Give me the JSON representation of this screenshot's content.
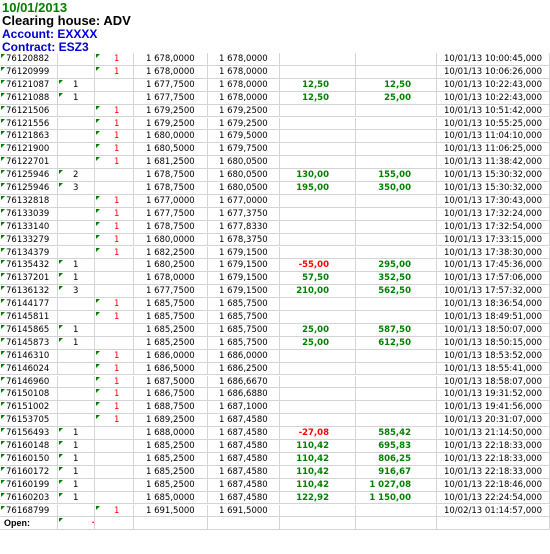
{
  "header": {
    "date": "10/01/2013",
    "clearing_house": "Clearing house: ADV",
    "account": "Account: EXXXX",
    "contract": "Contract: ESZ3"
  },
  "colors": {
    "positive": "#008000",
    "negative": "#ff0000",
    "account": "#0000cc",
    "grid": "#d4d4d4"
  },
  "rows": [
    {
      "id": "76120882",
      "buy": "",
      "sell": "1",
      "price": "1 678,0000",
      "avg": "1 678,0000",
      "pl": "",
      "cum": "",
      "time": "10/01/13 10:00:45,000",
      "m": [
        1,
        0,
        1,
        0
      ]
    },
    {
      "id": "76120999",
      "buy": "",
      "sell": "1",
      "price": "1 678,0000",
      "avg": "1 678,0000",
      "pl": "",
      "cum": "",
      "time": "10/01/13 10:06:26,000",
      "m": [
        1,
        0,
        1,
        0
      ]
    },
    {
      "id": "76121087",
      "buy": "1",
      "sell": "",
      "price": "1 677,7500",
      "avg": "1 678,0000",
      "pl": "12,50",
      "cum": "12,50",
      "time": "10/01/13 10:22:43,000",
      "m": [
        1,
        1,
        0,
        0
      ]
    },
    {
      "id": "76121088",
      "buy": "1",
      "sell": "",
      "price": "1 677,7500",
      "avg": "1 678,0000",
      "pl": "12,50",
      "cum": "25,00",
      "time": "10/01/13 10:22:43,000",
      "m": [
        1,
        1,
        0,
        0
      ]
    },
    {
      "id": "76121506",
      "buy": "",
      "sell": "1",
      "price": "1 679,2500",
      "avg": "1 679,2500",
      "pl": "",
      "cum": "",
      "time": "10/01/13 10:51:42,000",
      "m": [
        1,
        0,
        1,
        0
      ]
    },
    {
      "id": "76121556",
      "buy": "",
      "sell": "1",
      "price": "1 679,2500",
      "avg": "1 679,2500",
      "pl": "",
      "cum": "",
      "time": "10/01/13 10:55:25,000",
      "m": [
        1,
        0,
        1,
        0
      ]
    },
    {
      "id": "76121863",
      "buy": "",
      "sell": "1",
      "price": "1 680,0000",
      "avg": "1 679,5000",
      "pl": "",
      "cum": "",
      "time": "10/01/13 11:04:10,000",
      "m": [
        1,
        0,
        1,
        0
      ]
    },
    {
      "id": "76121900",
      "buy": "",
      "sell": "1",
      "price": "1 680,5000",
      "avg": "1 679,7500",
      "pl": "",
      "cum": "",
      "time": "10/01/13 11:06:25,000",
      "m": [
        1,
        0,
        1,
        0
      ]
    },
    {
      "id": "76122701",
      "buy": "",
      "sell": "1",
      "price": "1 681,2500",
      "avg": "1 680,0500",
      "pl": "",
      "cum": "",
      "time": "10/01/13 11:38:42,000",
      "m": [
        1,
        0,
        1,
        0
      ]
    },
    {
      "id": "76125946",
      "buy": "2",
      "sell": "",
      "price": "1 678,7500",
      "avg": "1 680,0500",
      "pl": "130,00",
      "cum": "155,00",
      "time": "10/01/13 15:30:32,000",
      "m": [
        1,
        1,
        0,
        0
      ]
    },
    {
      "id": "76125946",
      "buy": "3",
      "sell": "",
      "price": "1 678,7500",
      "avg": "1 680,0500",
      "pl": "195,00",
      "cum": "350,00",
      "time": "10/01/13 15:30:32,000",
      "m": [
        1,
        1,
        0,
        0
      ]
    },
    {
      "id": "76132818",
      "buy": "",
      "sell": "1",
      "price": "1 677,0000",
      "avg": "1 677,0000",
      "pl": "",
      "cum": "",
      "time": "10/01/13 17:30:43,000",
      "m": [
        1,
        0,
        1,
        0
      ]
    },
    {
      "id": "76133039",
      "buy": "",
      "sell": "1",
      "price": "1 677,7500",
      "avg": "1 677,3750",
      "pl": "",
      "cum": "",
      "time": "10/01/13 17:32:24,000",
      "m": [
        1,
        0,
        1,
        0
      ]
    },
    {
      "id": "76133140",
      "buy": "",
      "sell": "1",
      "price": "1 678,7500",
      "avg": "1 677,8330",
      "pl": "",
      "cum": "",
      "time": "10/01/13 17:32:54,000",
      "m": [
        1,
        0,
        1,
        0
      ]
    },
    {
      "id": "76133279",
      "buy": "",
      "sell": "1",
      "price": "1 680,0000",
      "avg": "1 678,3750",
      "pl": "",
      "cum": "",
      "time": "10/01/13 17:33:15,000",
      "m": [
        1,
        0,
        1,
        0
      ]
    },
    {
      "id": "76134379",
      "buy": "",
      "sell": "1",
      "price": "1 682,2500",
      "avg": "1 679,1500",
      "pl": "",
      "cum": "",
      "time": "10/01/13 17:38:30,000",
      "m": [
        1,
        0,
        1,
        0
      ]
    },
    {
      "id": "76135432",
      "buy": "1",
      "sell": "",
      "price": "1 680,2500",
      "avg": "1 679,1500",
      "pl": "-55,00",
      "cum": "295,00",
      "time": "10/01/13 17:45:36,000",
      "m": [
        1,
        1,
        0,
        0
      ]
    },
    {
      "id": "76137201",
      "buy": "1",
      "sell": "",
      "price": "1 678,0000",
      "avg": "1 679,1500",
      "pl": "57,50",
      "cum": "352,50",
      "time": "10/01/13 17:57:06,000",
      "m": [
        1,
        1,
        0,
        0
      ]
    },
    {
      "id": "76136132",
      "buy": "3",
      "sell": "",
      "price": "1 677,7500",
      "avg": "1 679,1500",
      "pl": "210,00",
      "cum": "562,50",
      "time": "10/01/13 17:57:32,000",
      "m": [
        1,
        1,
        0,
        0
      ]
    },
    {
      "id": "76144177",
      "buy": "",
      "sell": "1",
      "price": "1 685,7500",
      "avg": "1 685,7500",
      "pl": "",
      "cum": "",
      "time": "10/01/13 18:36:54,000",
      "m": [
        1,
        0,
        1,
        0
      ]
    },
    {
      "id": "76145811",
      "buy": "",
      "sell": "1",
      "price": "1 685,7500",
      "avg": "1 685,7500",
      "pl": "",
      "cum": "",
      "time": "10/01/13 18:49:51,000",
      "m": [
        1,
        0,
        1,
        0
      ]
    },
    {
      "id": "76145865",
      "buy": "1",
      "sell": "",
      "price": "1 685,2500",
      "avg": "1 685,7500",
      "pl": "25,00",
      "cum": "587,50",
      "time": "10/01/13 18:50:07,000",
      "m": [
        1,
        1,
        0,
        0
      ]
    },
    {
      "id": "76145873",
      "buy": "1",
      "sell": "",
      "price": "1 685,2500",
      "avg": "1 685,7500",
      "pl": "25,00",
      "cum": "612,50",
      "time": "10/01/13 18:50:15,000",
      "m": [
        1,
        1,
        0,
        0
      ]
    },
    {
      "id": "76146310",
      "buy": "",
      "sell": "1",
      "price": "1 686,0000",
      "avg": "1 686,0000",
      "pl": "",
      "cum": "",
      "time": "10/01/13 18:53:52,000",
      "m": [
        1,
        0,
        1,
        0
      ]
    },
    {
      "id": "76146024",
      "buy": "",
      "sell": "1",
      "price": "1 686,5000",
      "avg": "1 686,2500",
      "pl": "",
      "cum": "",
      "time": "10/01/13 18:55:41,000",
      "m": [
        1,
        0,
        1,
        0
      ]
    },
    {
      "id": "76146960",
      "buy": "",
      "sell": "1",
      "price": "1 687,5000",
      "avg": "1 686,6670",
      "pl": "",
      "cum": "",
      "time": "10/01/13 18:58:07,000",
      "m": [
        1,
        0,
        1,
        0
      ]
    },
    {
      "id": "76150108",
      "buy": "",
      "sell": "1",
      "price": "1 686,7500",
      "avg": "1 686,6880",
      "pl": "",
      "cum": "",
      "time": "10/01/13 19:31:52,000",
      "m": [
        1,
        0,
        1,
        0
      ]
    },
    {
      "id": "76151002",
      "buy": "",
      "sell": "1",
      "price": "1 688,7500",
      "avg": "1 687,1000",
      "pl": "",
      "cum": "",
      "time": "10/01/13 19:41:56,000",
      "m": [
        1,
        0,
        1,
        0
      ]
    },
    {
      "id": "76153705",
      "buy": "",
      "sell": "1",
      "price": "1 689,2500",
      "avg": "1 687,4580",
      "pl": "",
      "cum": "",
      "time": "10/01/13 20:31:07,000",
      "m": [
        1,
        0,
        1,
        0
      ]
    },
    {
      "id": "76156493",
      "buy": "1",
      "sell": "",
      "price": "1 688,0000",
      "avg": "1 687,4580",
      "pl": "-27,08",
      "cum": "585,42",
      "time": "10/01/13 21:14:50,000",
      "m": [
        1,
        1,
        0,
        0
      ]
    },
    {
      "id": "76160148",
      "buy": "1",
      "sell": "",
      "price": "1 685,2500",
      "avg": "1 687,4580",
      "pl": "110,42",
      "cum": "695,83",
      "time": "10/01/13 22:18:33,000",
      "m": [
        1,
        1,
        0,
        0
      ]
    },
    {
      "id": "76160150",
      "buy": "1",
      "sell": "",
      "price": "1 685,2500",
      "avg": "1 687,4580",
      "pl": "110,42",
      "cum": "806,25",
      "time": "10/01/13 22:18:33,000",
      "m": [
        1,
        1,
        0,
        0
      ]
    },
    {
      "id": "76160172",
      "buy": "1",
      "sell": "",
      "price": "1 685,2500",
      "avg": "1 687,4580",
      "pl": "110,42",
      "cum": "916,67",
      "time": "10/01/13 22:18:33,000",
      "m": [
        1,
        1,
        0,
        0
      ]
    },
    {
      "id": "76160199",
      "buy": "1",
      "sell": "",
      "price": "1 685,2500",
      "avg": "1 687,4580",
      "pl": "110,42",
      "cum": "1 027,08",
      "time": "10/01/13 22:18:46,000",
      "m": [
        1,
        1,
        0,
        0
      ]
    },
    {
      "id": "76160203",
      "buy": "1",
      "sell": "",
      "price": "1 685,0000",
      "avg": "1 687,4580",
      "pl": "122,92",
      "cum": "1 150,00",
      "time": "10/01/13 22:24:54,000",
      "m": [
        1,
        1,
        0,
        0
      ]
    },
    {
      "id": "76168799",
      "buy": "",
      "sell": "1",
      "price": "1 691,5000",
      "avg": "1 691,5000",
      "pl": "",
      "cum": "",
      "time": "10/02/13 01:14:57,000",
      "m": [
        1,
        0,
        1,
        0
      ]
    }
  ],
  "footer": {
    "label": "Open:",
    "value": "-1"
  }
}
